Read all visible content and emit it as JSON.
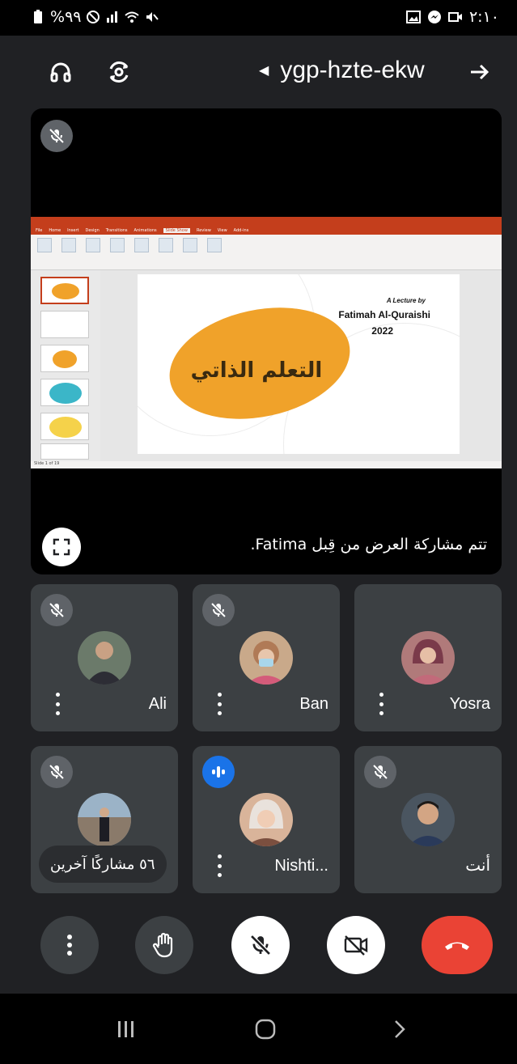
{
  "status_bar": {
    "battery": "%٩٩",
    "time": "٢:١٠"
  },
  "top_bar": {
    "meeting_code": "ygp-hzte-ekw",
    "audio_icon": "headphones-icon",
    "camera_switch_icon": "switch-camera-icon",
    "forward_icon": "arrow-right-icon"
  },
  "presentation": {
    "caption": "تتم مشاركة العرض من قِبل Fatima.",
    "slide": {
      "arabic_title": "التعلم الذاتي",
      "lecture_by": "A Lecture by",
      "author": "Fatimah Al-Quraishi",
      "year": "2022"
    },
    "ppt_tabs": [
      "File",
      "Home",
      "Insert",
      "Design",
      "Transitions",
      "Animations",
      "Slide Show",
      "Review",
      "View",
      "Add-ins"
    ],
    "active_tab": "Slide Show",
    "status_text": "Slide 1 of 19"
  },
  "participants": [
    {
      "name": "Ali",
      "muted": true,
      "avatar_color": "#6b7a6a"
    },
    {
      "name": "Ban",
      "muted": true,
      "avatar_color": "#c9a98a"
    },
    {
      "name": "Yosra",
      "muted": false,
      "avatar_color": "#b07a7a"
    },
    {
      "name": "",
      "muted": true,
      "avatar_color": "#7a8a99"
    },
    {
      "name": "Nishti...",
      "muted": false,
      "speaking": true,
      "avatar_color": "#d9b49a"
    },
    {
      "name": "أنت",
      "muted": true,
      "avatar_color": "#4a5560"
    }
  ],
  "others_pill": "٥٦ مشاركًا آخرين",
  "controls": {
    "more_icon": "more-vert-icon",
    "hand_icon": "raise-hand-icon",
    "mic_icon": "mic-off-icon",
    "camera_icon": "camera-off-icon",
    "end_call_icon": "end-call-icon"
  },
  "colors": {
    "background": "#202124",
    "tile": "#3c4043",
    "end_call": "#ea4335",
    "speaking": "#1a73e8",
    "ppt_accent": "#c43e1c",
    "slide_blob": "#f0a22a"
  }
}
